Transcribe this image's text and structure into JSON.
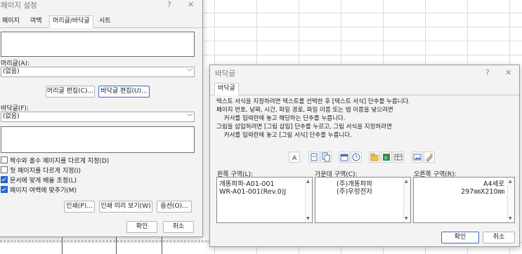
{
  "page_setup": {
    "title": "페이지 설정",
    "help": "?",
    "close": "✕",
    "tabs": [
      "페이지",
      "여백",
      "머리글/바닥글",
      "시트"
    ],
    "header_label": "머리글(A):",
    "header_value": "(없음)",
    "custom_header_button": "머리글 편집(C)...",
    "custom_footer_button": "바닥글 편집(U)...",
    "footer_label": "바닥글(F):",
    "footer_value": "(없음)",
    "options": [
      {
        "label": "짝수와 홀수 페이지를 다르게 지정(D)",
        "checked": false
      },
      {
        "label": "첫 페이지를 다르게 지정(I)",
        "checked": false
      },
      {
        "label": "문서에 맞게 배율 조정(L)",
        "checked": true
      },
      {
        "label": "페이지 여백에 맞추기(M)",
        "checked": true
      }
    ],
    "print_button": "인쇄(P)...",
    "print_preview_button": "인쇄 미리 보기(W)",
    "options_button": "옵션(O)...",
    "ok_button": "확인",
    "cancel_button": "취소"
  },
  "footer_dialog": {
    "title": "바닥글",
    "help": "?",
    "close": "✕",
    "tab": "바닥글",
    "instructions": [
      "텍스트 서식을 지정하려면 텍스트를 선택한 후 [텍스트 서식] 단추를 누릅니다.",
      "페이지 번호, 날짜, 시간, 파일 경로, 파일 이름 또는 탭 이름을 넣으려면",
      "    커서를 입력란에 놓고 해당하는 단추를 누릅니다.",
      "그림을 삽입하려면 [그림 삽입] 단추를 누르고, 그림 서식을 지정하려면",
      "    커서를 입력란에 놓고 [그림 서식] 단추를 누릅니다."
    ],
    "toolbar_icons": [
      "format-text-icon",
      "page-number-icon",
      "number-of-pages-icon",
      "date-icon",
      "time-icon",
      "file-path-icon",
      "file-name-icon",
      "sheet-name-icon",
      "insert-picture-icon",
      "format-picture-icon"
    ],
    "left_label": "왼쪽 구역(L):",
    "center_label": "가운데 구역(C):",
    "right_label": "오른쪽 구역(R):",
    "left_text": "개똥파파-A01-001\nWR-A01-001(Rev.0)J",
    "center_text": "(주)개똥파파\n(주)우렁전자",
    "right_text": "A4세로\n297㎜X210㎜",
    "ok_button": "확인",
    "cancel_button": "취소"
  }
}
